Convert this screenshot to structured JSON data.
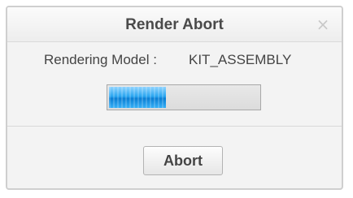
{
  "dialog": {
    "title": "Render Abort",
    "close_glyph": "×",
    "close_icon": "close-icon"
  },
  "render": {
    "model_label": "Rendering Model :",
    "model_name": "KIT_ASSEMBLY",
    "progress_fraction": 0.38,
    "progress_color": "#1a98e8"
  },
  "actions": {
    "abort_label": "Abort"
  }
}
